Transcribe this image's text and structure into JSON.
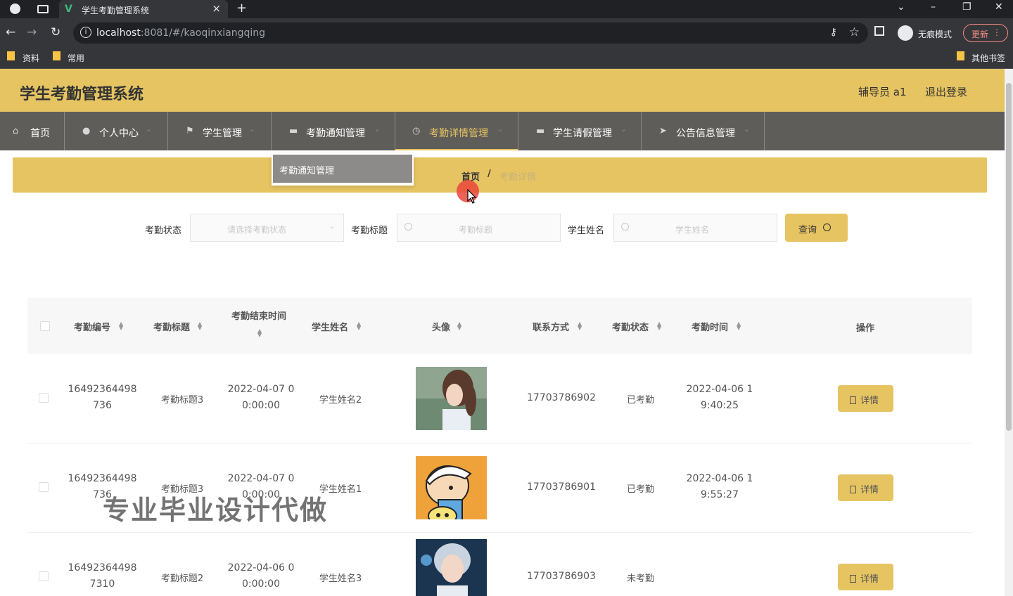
{
  "browser": {
    "tab_title": "学生考勤管理系统",
    "url_host": "localhost",
    "url_rest": ":8081/#/kaoqinxiangqing",
    "incognito_label": "无痕模式",
    "update_label": "更新",
    "bookmarks": [
      "资料",
      "常用"
    ],
    "other_bookmarks": "其他书签"
  },
  "header": {
    "title": "学生考勤管理系统",
    "user": "辅导员 a1",
    "logout": "退出登录"
  },
  "nav": {
    "items": [
      {
        "label": "首页",
        "icon": "home-icon"
      },
      {
        "label": "个人中心",
        "icon": "user-icon"
      },
      {
        "label": "学生管理",
        "icon": "flag-icon"
      },
      {
        "label": "考勤通知管理",
        "icon": "doc-icon"
      },
      {
        "label": "考勤详情管理",
        "icon": "clock-icon"
      },
      {
        "label": "学生请假管理",
        "icon": "doc-icon"
      },
      {
        "label": "公告信息管理",
        "icon": "send-icon"
      }
    ],
    "active": "考勤详情管理",
    "dropdown_item": "考勤通知管理"
  },
  "breadcrumb": {
    "home": "首页",
    "separator": "/",
    "current": "考勤详情"
  },
  "search": {
    "status_label": "考勤状态",
    "status_placeholder": "请选择考勤状态",
    "title_label": "考勤标题",
    "title_placeholder": "考勤标题",
    "name_label": "学生姓名",
    "name_placeholder": "学生姓名",
    "button": "查询"
  },
  "table": {
    "headers": [
      "考勤编号",
      "考勤标题",
      "考勤结束时间",
      "学生姓名",
      "头像",
      "联系方式",
      "考勤状态",
      "考勤时间",
      "操作"
    ],
    "rows": [
      {
        "id1": "16492364498",
        "id2": "736",
        "title": "考勤标题3",
        "end1": "2022-04-07 0",
        "end2": "0:00:00",
        "name": "学生姓名2",
        "phone": "17703786902",
        "status": "已考勤",
        "time1": "2022-04-06 1",
        "time2": "9:40:25",
        "action": "详情"
      },
      {
        "id1": "16492364498",
        "id2": "736",
        "title": "考勤标题3",
        "end1": "2022-04-07 0",
        "end2": "0:00:00",
        "name": "学生姓名1",
        "phone": "17703786901",
        "status": "已考勤",
        "time1": "2022-04-06 1",
        "time2": "9:55:27",
        "action": "详情"
      },
      {
        "id1": "16492364498",
        "id2": "7310",
        "title": "考勤标题2",
        "end1": "2022-04-06 0",
        "end2": "0:00:00",
        "name": "学生姓名3",
        "phone": "17703786903",
        "status": "未考勤",
        "time1": "",
        "time2": "",
        "action": "详情"
      }
    ]
  },
  "watermark": "专业毕业设计代做",
  "colors": {
    "accent": "#e6c462",
    "nav_bg": "#5f5d5a"
  }
}
